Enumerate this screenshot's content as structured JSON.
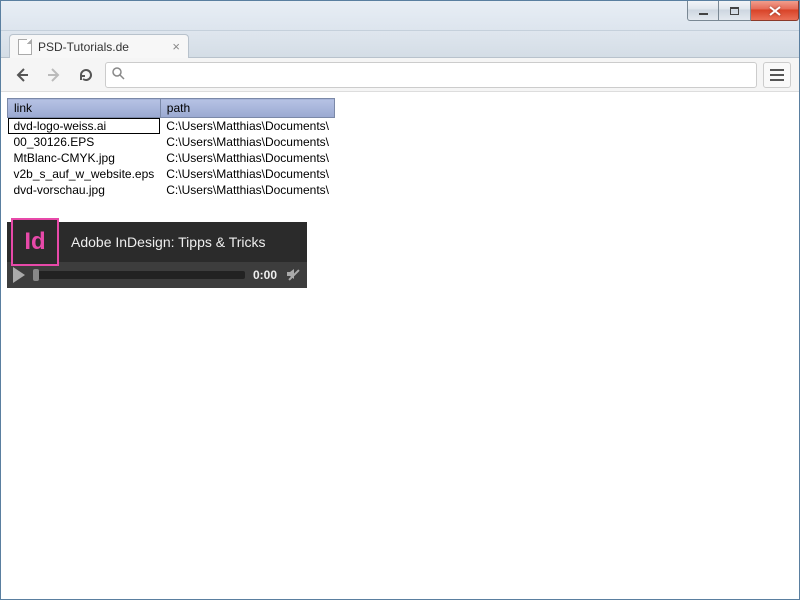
{
  "window": {
    "tab_title": "PSD-Tutorials.de"
  },
  "toolbar": {
    "url": ""
  },
  "table": {
    "headers": {
      "link": "link",
      "path": "path"
    },
    "rows": [
      {
        "link": "dvd-logo-weiss.ai",
        "path": "C:\\Users\\Matthias\\Documents\\"
      },
      {
        "link": "00_30126.EPS",
        "path": "C:\\Users\\Matthias\\Documents\\"
      },
      {
        "link": "MtBlanc-CMYK.jpg",
        "path": "C:\\Users\\Matthias\\Documents\\"
      },
      {
        "link": "v2b_s_auf_w_website.eps",
        "path": "C:\\Users\\Matthias\\Documents\\"
      },
      {
        "link": "dvd-vorschau.jpg",
        "path": "C:\\Users\\Matthias\\Documents\\"
      }
    ],
    "selected_index": 0
  },
  "video": {
    "logo_text": "Id",
    "title": "Adobe InDesign: Tipps & Tricks",
    "time": "0:00"
  }
}
